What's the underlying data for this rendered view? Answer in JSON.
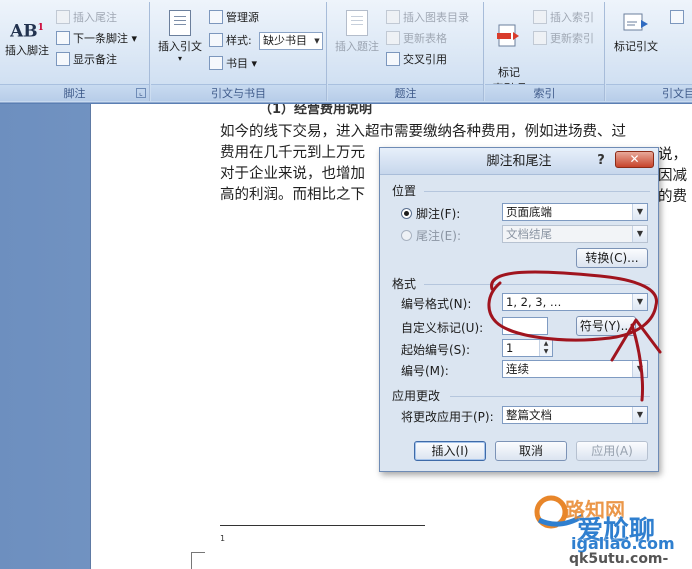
{
  "ribbon": {
    "footnotes_group": {
      "label": "脚注",
      "insert_footnote": "插入脚注",
      "insert_endnote": "插入尾注",
      "next_footnote": "下一条脚注",
      "show_notes": "显示备注",
      "launcher": "⌞"
    },
    "citations_group": {
      "label": "引文与书目",
      "insert_citation": "插入引文",
      "manage_sources": "管理源",
      "style_label": "样式:",
      "style_value": "缺少书目",
      "bibliography": "书目"
    },
    "captions_group": {
      "label": "题注",
      "insert_caption": "插入题注",
      "insert_table_of_figures": "插入图表目录",
      "update_table": "更新表格",
      "cross_reference": "交叉引用"
    },
    "index_group": {
      "label": "索引",
      "mark_entry": "标记\n索引项",
      "insert_index": "插入索引",
      "update_index": "更新索引"
    },
    "toa_group": {
      "label": "引文目",
      "mark_citation": "标记引文"
    }
  },
  "document": {
    "heading_fragment": "（1）经营费用说明",
    "lines": [
      "如今的线下交易，进入超市需要缴纳各种费用，例如进场费、过",
      "费用在几千元到上万元",
      "对于企业来说，也增加",
      "高的利润。而相比之下"
    ],
    "line_tails": [
      "说，",
      "因减",
      "的费"
    ],
    "footnote_marker": "1"
  },
  "watermark": {
    "text1": "路知网",
    "text2": "爱尬聊",
    "text3": "igaliao.com",
    "text4": "qk5utu.com-"
  },
  "dialog": {
    "title": "脚注和尾注",
    "help": "?",
    "close": "✕",
    "location_section": "位置",
    "footnote_label": "脚注(F):",
    "footnote_value": "页面底端",
    "endnote_label": "尾注(E):",
    "endnote_value": "文档结尾",
    "convert_button": "转换(C)...",
    "format_section": "格式",
    "number_format_label": "编号格式(N):",
    "number_format_value": "1, 2, 3, …",
    "custom_mark_label": "自定义标记(U):",
    "custom_mark_value": "",
    "symbol_button": "符号(Y)...",
    "start_at_label": "起始编号(S):",
    "start_at_value": "1",
    "numbering_label": "编号(M):",
    "numbering_value": "连续",
    "apply_section": "应用更改",
    "apply_to_label": "将更改应用于(P):",
    "apply_to_value": "整篇文档",
    "insert_button": "插入(I)",
    "cancel_button": "取消",
    "apply_button": "应用(A)"
  },
  "colors": {
    "annotation": "#a0141e",
    "ribbon_bg": "#dbe7f5",
    "dialog_bg": "#dbe5f1",
    "watermark_orange": "#e8862a",
    "watermark_blue": "#2f7fcf"
  }
}
